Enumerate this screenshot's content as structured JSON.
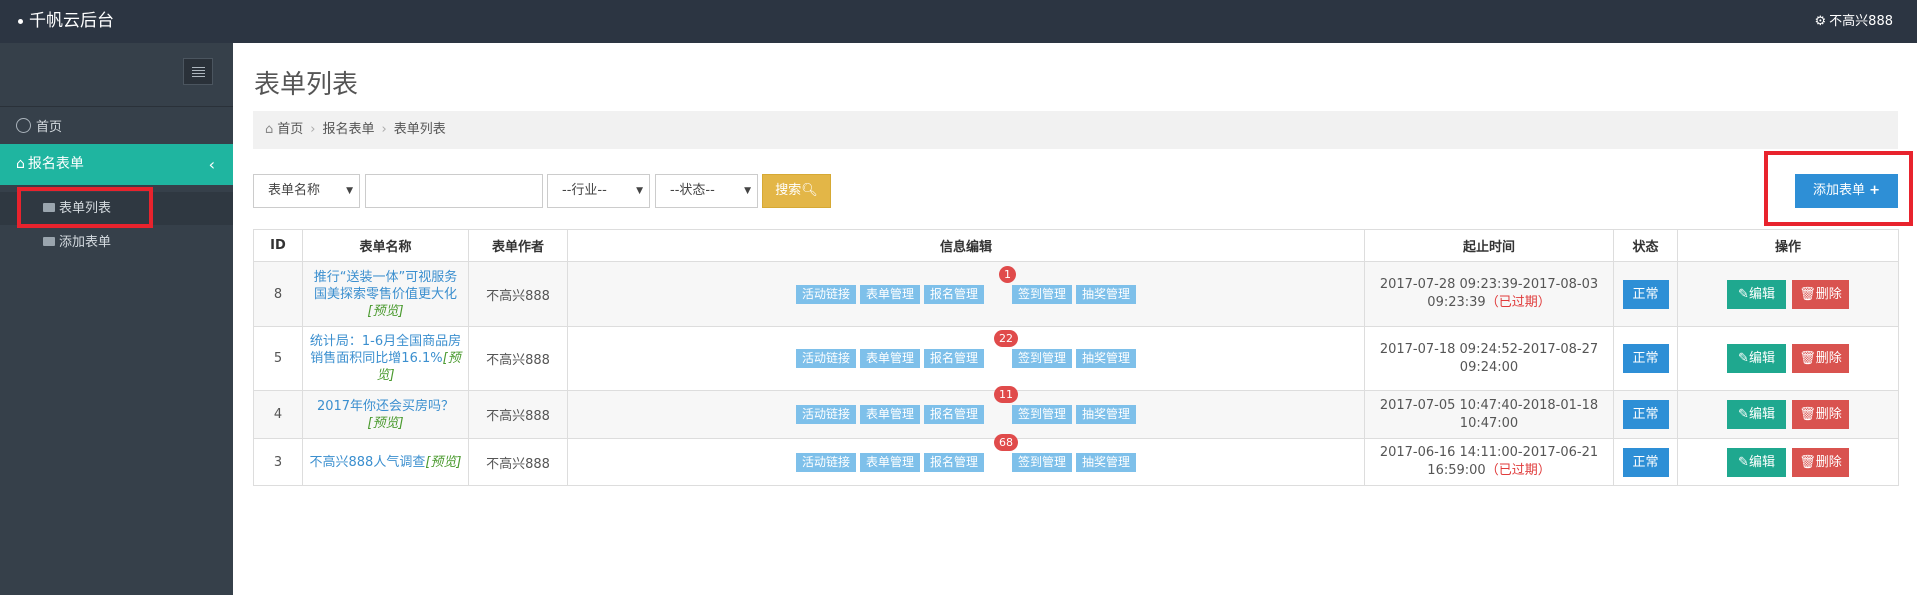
{
  "app": {
    "title": "千帆云后台",
    "user": "不高兴888"
  },
  "sidebar": {
    "home": "首页",
    "active_section": "报名表单",
    "items": [
      {
        "label": "表单列表"
      },
      {
        "label": "添加表单"
      }
    ]
  },
  "page": {
    "title": "表单列表",
    "breadcrumb": [
      "首页",
      "报名表单",
      "表单列表"
    ]
  },
  "filters": {
    "field_select": "表单名称",
    "search_value": "",
    "industry_select": "--行业--",
    "status_select": "--状态--",
    "search_button": "搜索",
    "add_button": "添加表单"
  },
  "table": {
    "headers": [
      "ID",
      "表单名称",
      "表单作者",
      "信息编辑",
      "起止时间",
      "状态",
      "操作"
    ],
    "info_tags": [
      "活动链接",
      "表单管理",
      "报名管理",
      "签到管理",
      "抽奖管理"
    ],
    "preview_label": "[预览]",
    "expired_label": "（已过期）",
    "edit_label": "编辑",
    "delete_label": "删除",
    "rows": [
      {
        "id": "8",
        "name": "推行“送装一体”可视服务 国美探索零售价值更大化",
        "author": "不高兴888",
        "badge": "1",
        "time_start": "2017-07-28 09:23:39-2017-08-03",
        "time_end": "09:23:39",
        "expired": true,
        "status": "正常"
      },
      {
        "id": "5",
        "name": "统计局：1-6月全国商品房销售面积同比增16.1%",
        "author": "不高兴888",
        "badge": "22",
        "time_start": "2017-07-18 09:24:52-2017-08-27",
        "time_end": "09:24:00",
        "expired": false,
        "status": "正常"
      },
      {
        "id": "4",
        "name": "2017年你还会买房吗？",
        "author": "不高兴888",
        "badge": "11",
        "time_start": "2017-07-05 10:47:40-2018-01-18",
        "time_end": "10:47:00",
        "expired": false,
        "status": "正常"
      },
      {
        "id": "3",
        "name": "不高兴888人气调查",
        "author": "不高兴888",
        "badge": "68",
        "time_start": "2017-06-16 14:11:00-2017-06-21",
        "time_end": "16:59:00",
        "expired": true,
        "status": "正常"
      }
    ]
  }
}
